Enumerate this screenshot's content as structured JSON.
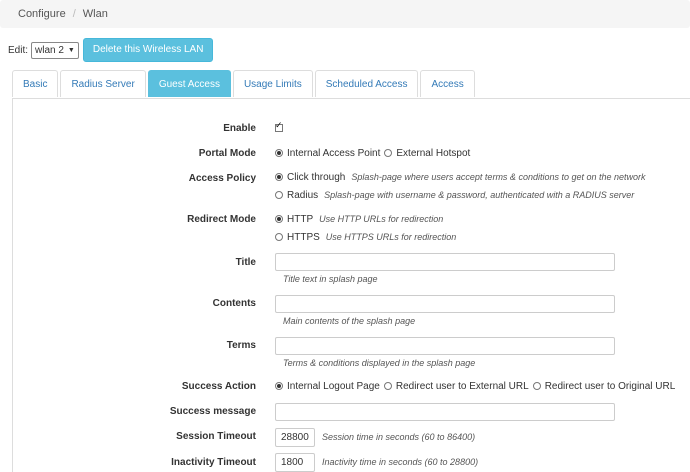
{
  "breadcrumb": {
    "items": [
      "Configure",
      "Wlan"
    ],
    "separator": "/"
  },
  "edit": {
    "label": "Edit:",
    "selected_wlan": "wlan 2",
    "delete_button": "Delete this Wireless LAN"
  },
  "tabs": [
    {
      "label": "Basic",
      "active": false
    },
    {
      "label": "Radius Server",
      "active": false
    },
    {
      "label": "Guest Access",
      "active": true
    },
    {
      "label": "Usage Limits",
      "active": false
    },
    {
      "label": "Scheduled Access",
      "active": false
    },
    {
      "label": "Access",
      "active": false
    }
  ],
  "form": {
    "enable": {
      "label": "Enable",
      "checked": true
    },
    "portal_mode": {
      "label": "Portal Mode",
      "options": [
        "Internal Access Point",
        "External Hotspot"
      ],
      "selected": "Internal Access Point"
    },
    "access_policy": {
      "label": "Access Policy",
      "options": [
        {
          "label": "Click through",
          "help": "Splash-page where users accept terms & conditions to get on the network"
        },
        {
          "label": "Radius",
          "help": "Splash-page with username & password, authenticated with a RADIUS server"
        }
      ],
      "selected": "Click through"
    },
    "redirect_mode": {
      "label": "Redirect Mode",
      "options": [
        {
          "label": "HTTP",
          "help": "Use HTTP URLs for redirection"
        },
        {
          "label": "HTTPS",
          "help": "Use HTTPS URLs for redirection"
        }
      ],
      "selected": "HTTP"
    },
    "title": {
      "label": "Title",
      "value": "",
      "help": "Title text in splash page"
    },
    "contents": {
      "label": "Contents",
      "value": "",
      "help": "Main contents of the splash page"
    },
    "terms": {
      "label": "Terms",
      "value": "",
      "help": "Terms & conditions displayed in the splash page"
    },
    "success_action": {
      "label": "Success Action",
      "options": [
        "Internal Logout Page",
        "Redirect user to External URL",
        "Redirect user to Original URL"
      ],
      "selected": "Internal Logout Page"
    },
    "success_message": {
      "label": "Success message",
      "value": ""
    },
    "session_timeout": {
      "label": "Session Timeout",
      "value": "28800",
      "help": "Session time in seconds (60 to 86400)"
    },
    "inactivity_timeout": {
      "label": "Inactivity Timeout",
      "value": "1800",
      "help": "Inactivity time in seconds (60 to 28800)"
    }
  }
}
